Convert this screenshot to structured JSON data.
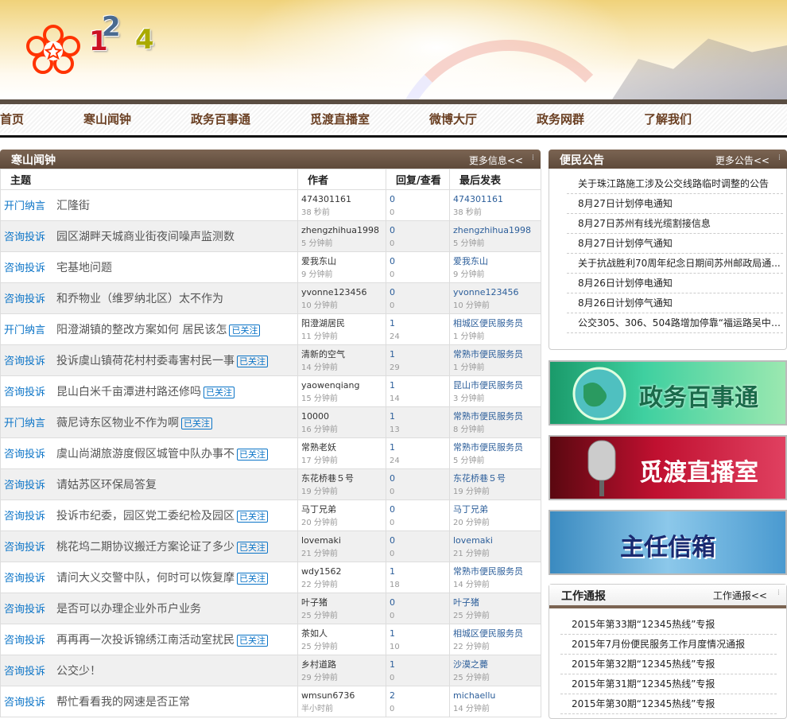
{
  "logo": {
    "digits": [
      "1",
      "2",
      "4"
    ]
  },
  "nav": [
    "首页",
    "寒山闻钟",
    "政务百事通",
    "觅渡直播室",
    "微博大厅",
    "政务网群",
    "了解我们"
  ],
  "forum": {
    "title": "寒山闻钟",
    "more": "更多信息<<",
    "columns": [
      "主题",
      "作者",
      "回复/查看",
      "最后发表"
    ],
    "followed_label": "已关注",
    "rows": [
      {
        "cat": "开门纳言",
        "title": "汇隆街",
        "followed": false,
        "author": "474301161",
        "author_time": "38 秒前",
        "replies": "0",
        "views": "0",
        "last_user": "474301161",
        "last_time": "38 秒前"
      },
      {
        "cat": "咨询投诉",
        "title": "园区湖畔天城商业街夜间噪声监测数",
        "followed": false,
        "author": "zhengzhihua1998",
        "author_time": "5 分钟前",
        "replies": "0",
        "views": "0",
        "last_user": "zhengzhihua1998",
        "last_time": "5 分钟前"
      },
      {
        "cat": "咨询投诉",
        "title": "宅基地问题",
        "followed": false,
        "author": "爱我东山",
        "author_time": "9 分钟前",
        "replies": "0",
        "views": "0",
        "last_user": "爱我东山",
        "last_time": "9 分钟前"
      },
      {
        "cat": "咨询投诉",
        "title": "和乔物业（维罗纳北区）太不作为",
        "followed": false,
        "author": "yvonne123456",
        "author_time": "10 分钟前",
        "replies": "0",
        "views": "0",
        "last_user": "yvonne123456",
        "last_time": "10 分钟前"
      },
      {
        "cat": "开门纳言",
        "title": "阳澄湖镇的整改方案如何 居民该怎",
        "followed": true,
        "author": "阳澄湖居民",
        "author_time": "11 分钟前",
        "replies": "1",
        "views": "24",
        "last_user": "相城区便民服务员",
        "last_time": "1 分钟前"
      },
      {
        "cat": "咨询投诉",
        "title": "投诉虞山镇荷花村村委毒害村民一事",
        "followed": true,
        "author": "清新的空气",
        "author_time": "14 分钟前",
        "replies": "1",
        "views": "29",
        "last_user": "常熟市便民服务员",
        "last_time": "1 分钟前"
      },
      {
        "cat": "咨询投诉",
        "title": "昆山白米千亩潭进村路还修吗",
        "followed": true,
        "author": "yaowenqiang",
        "author_time": "15 分钟前",
        "replies": "1",
        "views": "14",
        "last_user": "昆山市便民服务员",
        "last_time": "3 分钟前"
      },
      {
        "cat": "开门纳言",
        "title": "薇尼诗东区物业不作为啊",
        "followed": true,
        "author": "10000",
        "author_time": "16 分钟前",
        "replies": "1",
        "views": "13",
        "last_user": "常熟市便民服务员",
        "last_time": "8 分钟前"
      },
      {
        "cat": "咨询投诉",
        "title": "虞山尚湖旅游度假区城管中队办事不",
        "followed": true,
        "author": "常熟老妖",
        "author_time": "17 分钟前",
        "replies": "1",
        "views": "24",
        "last_user": "常熟市便民服务员",
        "last_time": "5 分钟前"
      },
      {
        "cat": "咨询投诉",
        "title": "请姑苏区环保局答复",
        "followed": false,
        "author": "东花桥巷５号",
        "author_time": "19 分钟前",
        "replies": "0",
        "views": "0",
        "last_user": "东花桥巷５号",
        "last_time": "19 分钟前"
      },
      {
        "cat": "咨询投诉",
        "title": "投诉市纪委，园区党工委纪检及园区",
        "followed": true,
        "author": "马丁兄弟",
        "author_time": "20 分钟前",
        "replies": "0",
        "views": "0",
        "last_user": "马丁兄弟",
        "last_time": "20 分钟前"
      },
      {
        "cat": "咨询投诉",
        "title": "桃花坞二期协议搬迁方案论证了多少",
        "followed": true,
        "author": "lovemaki",
        "author_time": "21 分钟前",
        "replies": "0",
        "views": "0",
        "last_user": "lovemaki",
        "last_time": "21 分钟前"
      },
      {
        "cat": "咨询投诉",
        "title": "请问大义交警中队，何时可以恢复摩",
        "followed": true,
        "author": "wdy1562",
        "author_time": "22 分钟前",
        "replies": "1",
        "views": "18",
        "last_user": "常熟市便民服务员",
        "last_time": "14 分钟前"
      },
      {
        "cat": "咨询投诉",
        "title": "是否可以办理企业外币户业务",
        "followed": false,
        "author": "叶子猪",
        "author_time": "25 分钟前",
        "replies": "0",
        "views": "0",
        "last_user": "叶子猪",
        "last_time": "25 分钟前"
      },
      {
        "cat": "咨询投诉",
        "title": "再再再一次投诉锦绣江南活动室扰民",
        "followed": true,
        "author": "茶如人",
        "author_time": "25 分钟前",
        "replies": "1",
        "views": "10",
        "last_user": "相城区便民服务员",
        "last_time": "22 分钟前"
      },
      {
        "cat": "咨询投诉",
        "title": "公交少！",
        "followed": false,
        "author": "乡村道路",
        "author_time": "29 分钟前",
        "replies": "1",
        "views": "0",
        "last_user": "沙漠之薨",
        "last_time": "25 分钟前"
      },
      {
        "cat": "咨询投诉",
        "title": "帮忙看看我的网速是否正常",
        "followed": false,
        "author": "wmsun6736",
        "author_time": "半小时前",
        "replies": "2",
        "views": "0",
        "last_user": "michaellu",
        "last_time": "14 分钟前"
      }
    ]
  },
  "notice": {
    "title": "便民公告",
    "more": "更多公告<<",
    "items": [
      "关于珠江路施工涉及公交线路临时调整的公告",
      "8月27日计划停电通知",
      "8月27日苏州有线光缆割接信息",
      "8月27日计划停气通知",
      "关于抗战胜利70周年纪念日期间苏州邮政局通...",
      "8月26日计划停电通知",
      "8月26日计划停气通知",
      "公交305、306、504路增加停靠“福运路吴中西..."
    ]
  },
  "banners": [
    "政务百事通",
    "觅渡直播室",
    "主任信箱"
  ],
  "work": {
    "title": "工作通报",
    "more": "工作通报<<",
    "items": [
      "2015年第33期“12345热线”专报",
      "2015年7月份便民服务工作月度情况通报",
      "2015年第32期“12345热线”专报",
      "2015年第31期“12345热线”专报",
      "2015年第30期“12345热线”专报"
    ]
  }
}
